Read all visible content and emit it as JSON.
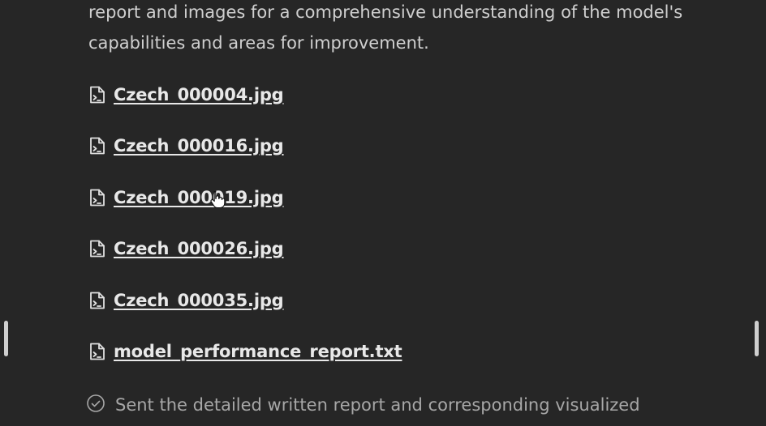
{
  "intro": {
    "line1": "report and images for a comprehensive understanding of the model's",
    "line2": "capabilities and areas for improvement."
  },
  "files": [
    {
      "name": "Czech_000004.jpg",
      "icon": "file-script-icon"
    },
    {
      "name": "Czech_000016.jpg",
      "icon": "file-script-icon"
    },
    {
      "name": "Czech_000019.jpg",
      "icon": "file-script-icon"
    },
    {
      "name": "Czech_000026.jpg",
      "icon": "file-script-icon"
    },
    {
      "name": "Czech_000035.jpg",
      "icon": "file-script-icon"
    },
    {
      "name": "model_performance_report.txt",
      "icon": "file-script-icon"
    }
  ],
  "status": {
    "icon": "check-circle-icon",
    "text": "Sent the detailed written report and corresponding visualized"
  },
  "colors": {
    "background": "#262626",
    "link": "#e8e8e8",
    "muted": "#a7a7a7"
  }
}
